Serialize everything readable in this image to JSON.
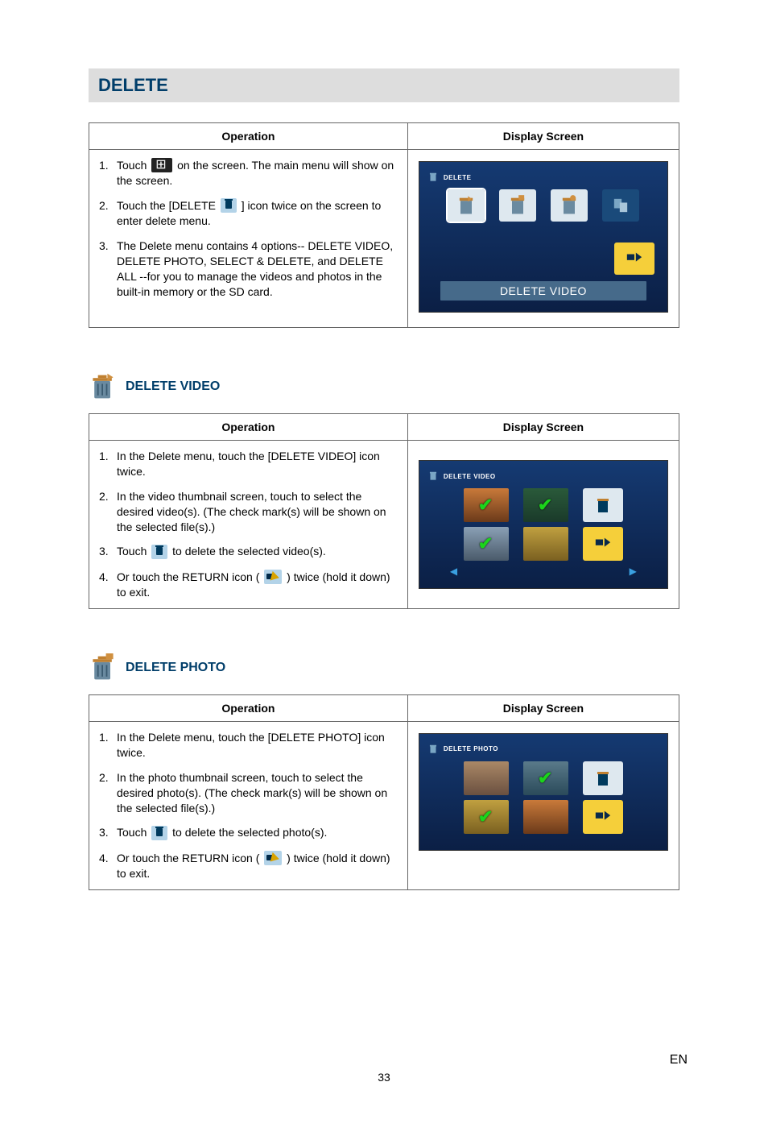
{
  "page_number": "33",
  "language_code": "EN",
  "section_title": "DELETE",
  "table_headers": {
    "operation": "Operation",
    "display_screen": "Display Screen"
  },
  "delete_section": {
    "steps": [
      {
        "num": "1.",
        "pre": "Touch ",
        "post": " on the screen. The main menu will show on the screen."
      },
      {
        "num": "2.",
        "pre": "Touch the [DELETE ",
        "post": " ] icon twice on the screen to enter delete menu."
      },
      {
        "num": "3.",
        "t": "The Delete menu contains 4 options-- DELETE VIDEO, DELETE PHOTO, SELECT & DELETE, and DELETE ALL --for you to manage the videos and photos in the built-in memory or the SD card."
      }
    ],
    "screen_header": "DELETE",
    "screen_caption": "DELETE VIDEO"
  },
  "delete_video": {
    "heading": "DELETE VIDEO",
    "steps": [
      {
        "num": "1.",
        "t": "In the Delete menu, touch the [DELETE VIDEO] icon twice."
      },
      {
        "num": "2.",
        "t": "In the video thumbnail screen, touch to select the desired video(s). (The check mark(s) will be shown on the selected file(s).)"
      },
      {
        "num": "3.",
        "pre": "Touch ",
        "post": " to delete the selected video(s)."
      },
      {
        "num": "4.",
        "pre": "Or touch the RETURN icon ( ",
        "post": " ) twice (hold it down) to exit."
      }
    ],
    "screen_header": "DELETE VIDEO"
  },
  "delete_photo": {
    "heading": "DELETE PHOTO",
    "steps": [
      {
        "num": "1.",
        "t": "In the Delete menu, touch the [DELETE PHOTO] icon twice."
      },
      {
        "num": "2.",
        "t": "In the photo thumbnail screen, touch to select the desired photo(s). (The check mark(s) will be shown on the selected file(s).)"
      },
      {
        "num": "3.",
        "pre": "Touch ",
        "post": " to delete the selected photo(s)."
      },
      {
        "num": "4.",
        "pre": "Or touch the RETURN icon ( ",
        "post": " ) twice (hold it down) to exit."
      }
    ],
    "screen_header": "DELETE PHOTO"
  }
}
